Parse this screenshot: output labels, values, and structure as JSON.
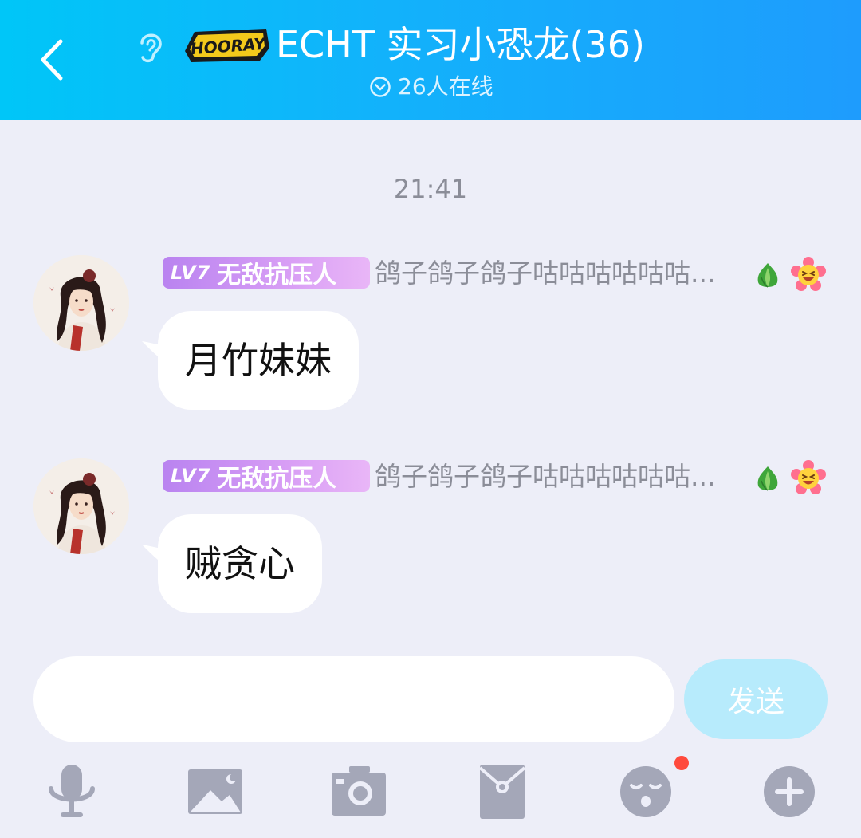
{
  "header": {
    "title": "ECHT 实习小恐龙(36)",
    "logo_text": "HOORAY",
    "online_status": "26人在线",
    "background_color": "#12b2fb"
  },
  "icons": {
    "back": "chevron-left-icon",
    "listen_mode": "ear-icon",
    "online": "chevron-down-circle-icon",
    "sprout": "sprout-icon",
    "flower_emoji": "laughing-flower-icon",
    "toolbar": [
      "microphone-icon",
      "image-icon",
      "camera-icon",
      "red-packet-icon",
      "emoji-icon",
      "plus-icon"
    ]
  },
  "chat": {
    "timestamp": "21:41",
    "messages": [
      {
        "level": "LV7",
        "title": "无敌抗压人",
        "nickname": "鸽子鸽子鸽子咕咕咕咕咕咕...",
        "text": "月竹妹妹"
      },
      {
        "level": "LV7",
        "title": "无敌抗压人",
        "nickname": "鸽子鸽子鸽子咕咕咕咕咕咕...",
        "text": "贼贪心"
      }
    ]
  },
  "composer": {
    "input_value": "",
    "send_label": "发送",
    "send_color": "#b7ebfc"
  },
  "toolbar": {
    "emoji_has_notification": true,
    "icon_color": "#a4a7b8"
  },
  "colors": {
    "background": "#edeef8",
    "level_badge": "#c490f2",
    "notification_dot": "#ff4a3d"
  }
}
